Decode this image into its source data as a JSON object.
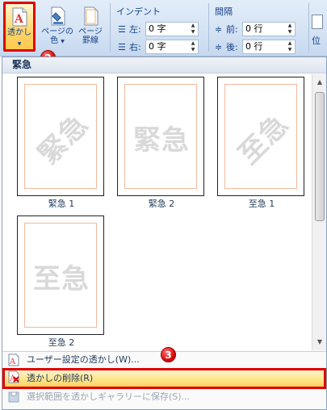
{
  "ribbon": {
    "watermark_label": "透かし",
    "page_color_label_1": "ページの",
    "page_color_label_2": "色",
    "page_border_label_1": "ページ",
    "page_border_label_2": "罫線",
    "indent_title": "インデント",
    "spacing_title": "間隔",
    "indent_left_label": "左:",
    "indent_left_value": "0 字",
    "indent_right_label": "右:",
    "indent_right_value": "0 字",
    "space_before_label": "前:",
    "space_before_value": "0 行",
    "space_after_label": "後:",
    "space_after_value": "0 行",
    "position_label": "位"
  },
  "gallery": {
    "section_title": "緊急",
    "tiles": [
      {
        "watermark_text": "緊急",
        "caption": "緊急 1",
        "diagonal": true
      },
      {
        "watermark_text": "緊急",
        "caption": "緊急 2",
        "diagonal": false
      },
      {
        "watermark_text": "至急",
        "caption": "至急 1",
        "diagonal": true
      },
      {
        "watermark_text": "至急",
        "caption": "至急 2",
        "diagonal": false
      }
    ]
  },
  "menu": {
    "custom": "ユーザー設定の透かし(W)...",
    "remove": "透かしの削除(R)",
    "save_selection": "選択範囲を透かしギャラリーに保存(S)..."
  },
  "badges": {
    "step2": "2",
    "step3": "3"
  },
  "colors": {
    "highlight_border": "#e00000",
    "hover_fill": "#ffe48c",
    "ribbon_text": "#15428b"
  }
}
